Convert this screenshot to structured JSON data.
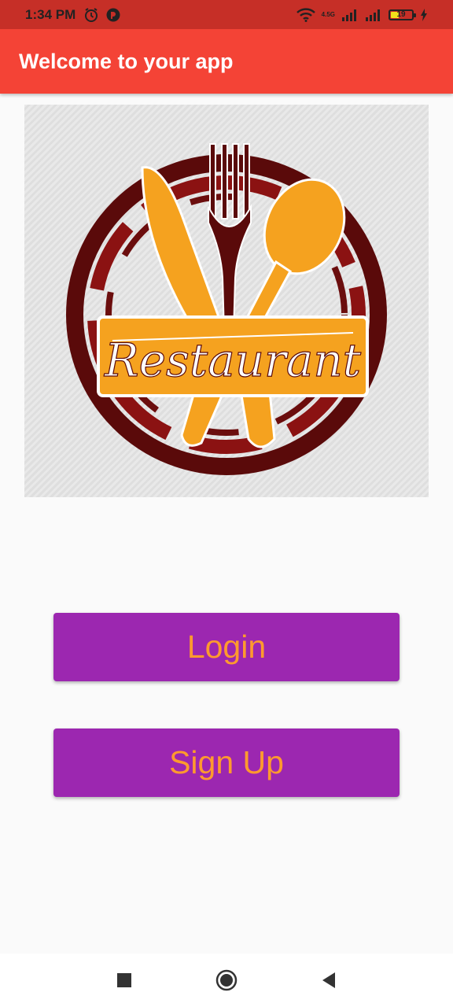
{
  "status_bar": {
    "time": "1:34 PM",
    "network_label": "4.5G",
    "battery_level": "19",
    "icons": [
      "alarm-icon",
      "app-notification-icon",
      "wifi-icon",
      "signal-icon",
      "signal-icon-2",
      "battery-icon",
      "charging-icon"
    ]
  },
  "app_bar": {
    "title": "Welcome to your app"
  },
  "logo": {
    "text": "Restaurant",
    "colors": {
      "orange": "#f5a21f",
      "dark_red": "#5a0a0a",
      "red_ring": "#7b1010"
    }
  },
  "buttons": {
    "login_label": "Login",
    "signup_label": "Sign Up",
    "background": "#9c27b0",
    "text_color": "#ff9a2e"
  },
  "nav_bar": {
    "icons": [
      "recents-square-icon",
      "home-circle-icon",
      "back-triangle-icon"
    ]
  },
  "theme": {
    "status_bar_color": "#c62f27",
    "app_bar_color": "#f44336",
    "page_background": "#fafafa"
  }
}
